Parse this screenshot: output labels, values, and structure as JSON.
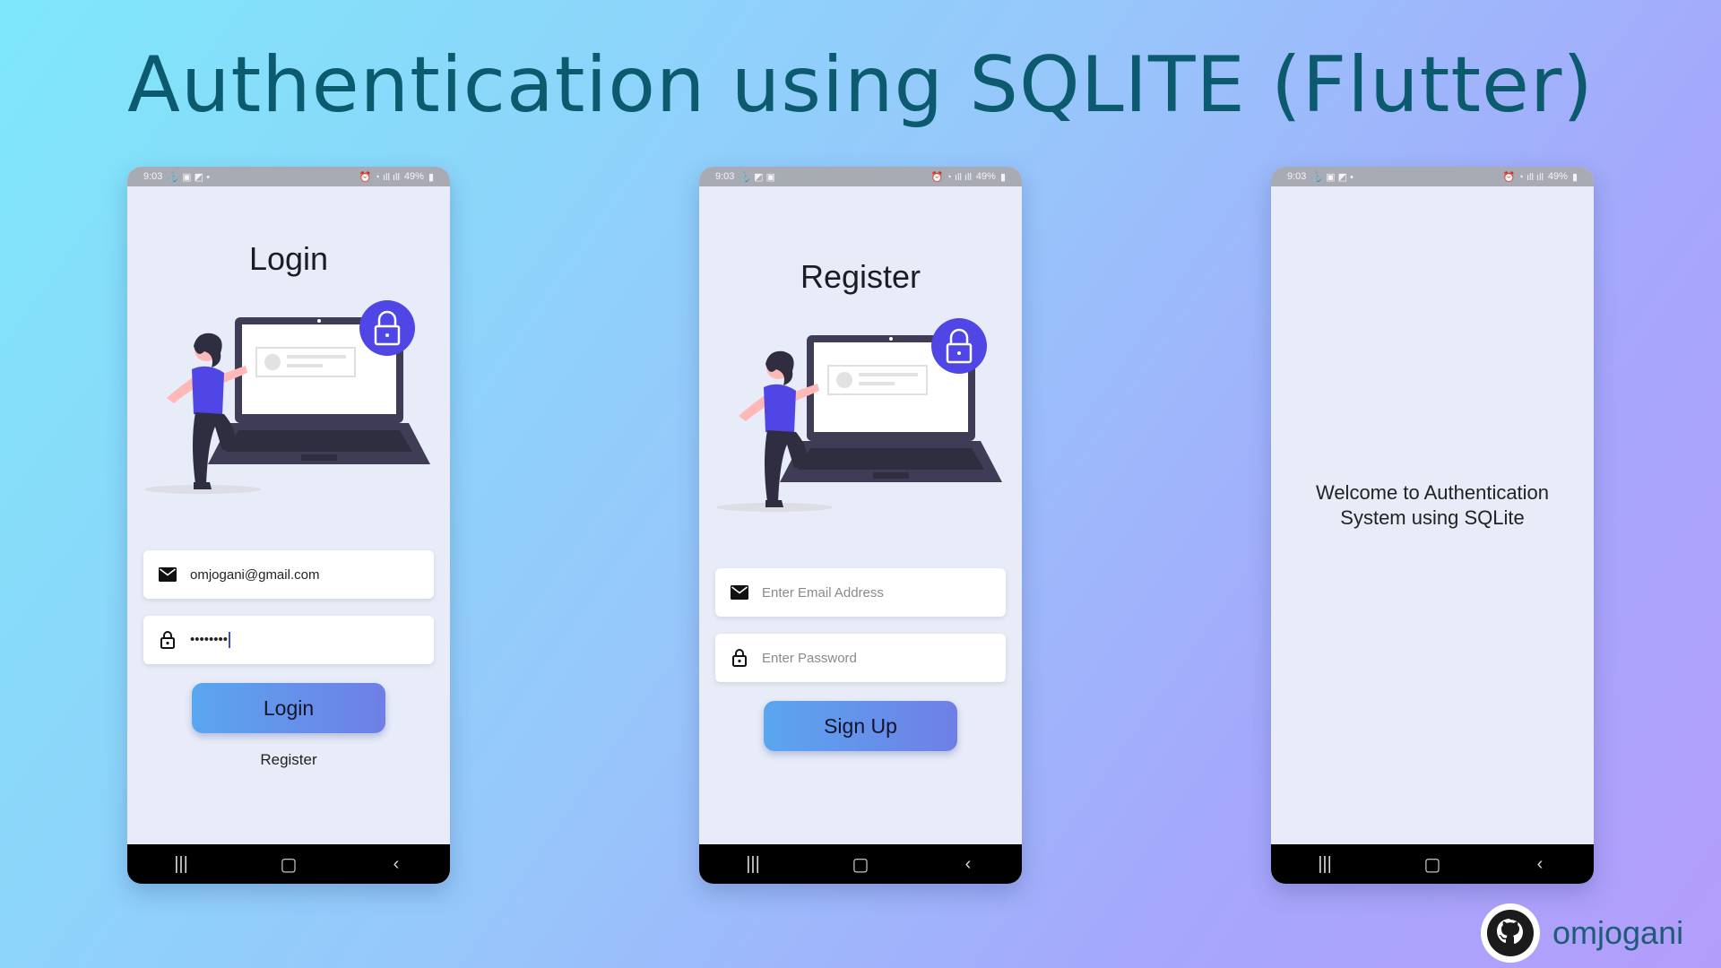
{
  "heading": "Authentication using SQLITE (Flutter)",
  "status": {
    "time": "9:03",
    "battery": "49%"
  },
  "login": {
    "title": "Login",
    "email_value": "omjogani@gmail.com",
    "password_value": "••••••••",
    "button": "Login",
    "link": "Register"
  },
  "register": {
    "title": "Register",
    "email_placeholder": "Enter Email Address",
    "password_placeholder": "Enter Password",
    "button": "Sign Up"
  },
  "home": {
    "welcome_line1": "Welcome to Authentication",
    "welcome_line2": "System using SQLite"
  },
  "brand": {
    "name": "omjogani",
    "icon": "github-icon"
  },
  "icons": {
    "email": "mail-icon",
    "password": "lock-icon",
    "nav_recent": "recent-apps-icon",
    "nav_home": "home-icon",
    "nav_back": "back-icon"
  },
  "colors": {
    "accent": "#5046e5",
    "button_start": "#5aa6ef",
    "button_end": "#6f7fe6",
    "screen_bg": "#e8ecf8",
    "title": "#0b5a6e"
  }
}
